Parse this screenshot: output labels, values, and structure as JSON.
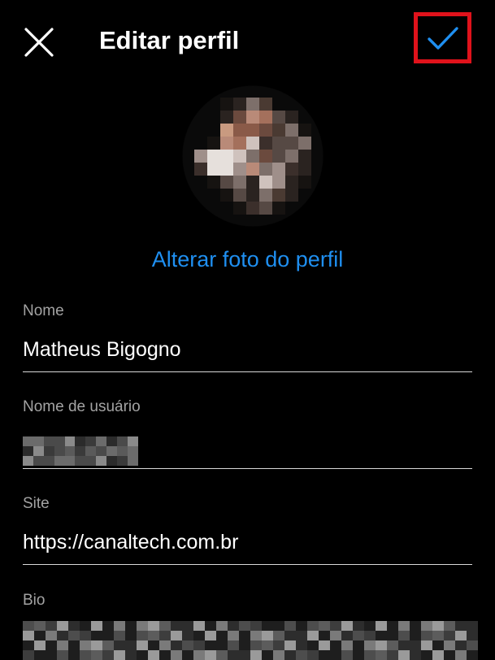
{
  "header": {
    "title": "Editar perfil",
    "close_icon": "close-icon",
    "confirm_icon": "checkmark-icon",
    "accent_color": "#1f8ff0",
    "highlight_color": "#e0121b"
  },
  "profile": {
    "change_photo_label": "Alterar foto do perfil"
  },
  "fields": {
    "name": {
      "label": "Nome",
      "value": "Matheus Bigogno"
    },
    "username": {
      "label": "Nome de usuário",
      "value": ""
    },
    "site": {
      "label": "Site",
      "value": "https://canaltech.com.br"
    },
    "bio": {
      "label": "Bio",
      "value": ""
    }
  }
}
